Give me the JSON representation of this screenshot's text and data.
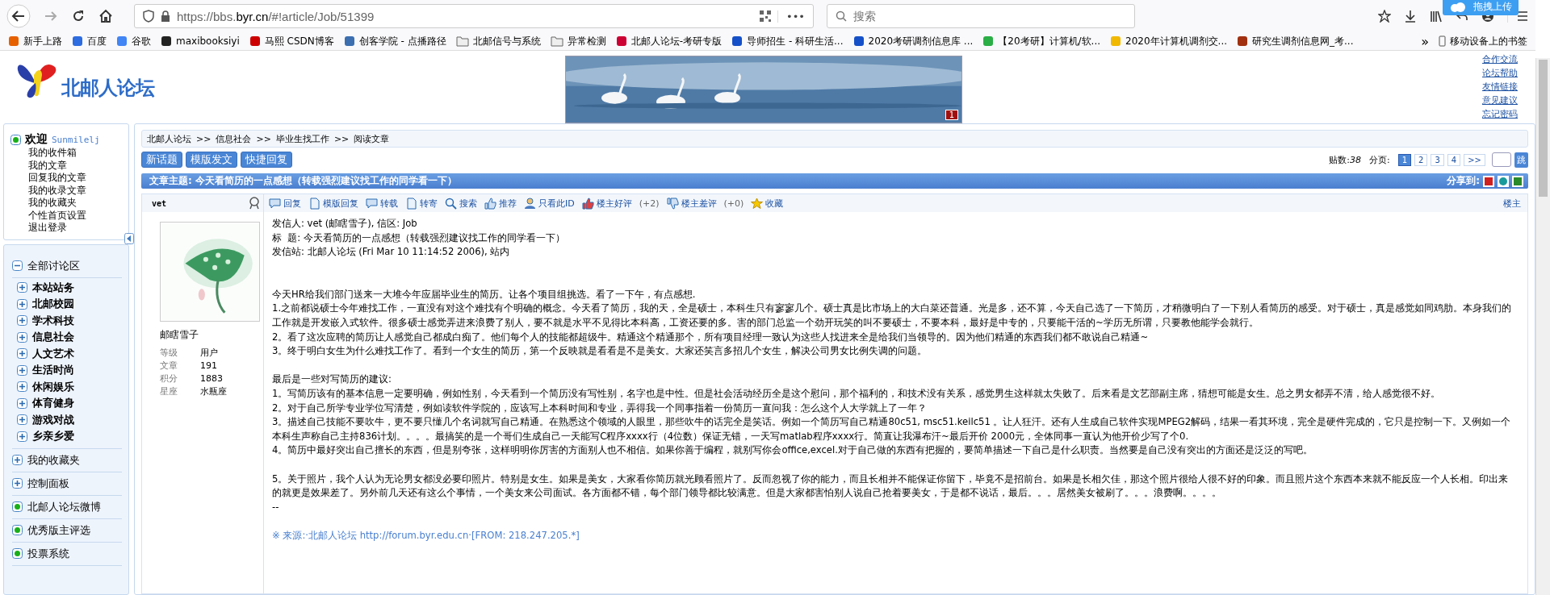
{
  "browser": {
    "url_prefix": "https://bbs.",
    "url_domain": "byr.cn",
    "url_path": "/#!article/Job/51399",
    "search_placeholder": "搜索",
    "more": "•••",
    "upload_popup": "拖拽上传",
    "bookmarks": [
      {
        "label": "新手上路",
        "kind": "site"
      },
      {
        "label": "百度",
        "kind": "site"
      },
      {
        "label": "谷歌",
        "kind": "site"
      },
      {
        "label": "maxibooksiyi",
        "kind": "site"
      },
      {
        "label": "马熙 CSDN博客",
        "kind": "site"
      },
      {
        "label": "创客学院 - 点播路径",
        "kind": "site"
      },
      {
        "label": "北邮信号与系统",
        "kind": "folder"
      },
      {
        "label": "异常检测",
        "kind": "folder"
      },
      {
        "label": "北邮人论坛-考研专版",
        "kind": "site"
      },
      {
        "label": "导师招生 - 科研生活...",
        "kind": "site"
      },
      {
        "label": "2020考研调剂信息库 ...",
        "kind": "site"
      },
      {
        "label": "【20考研】计算机/软...",
        "kind": "site"
      },
      {
        "label": "2020年计算机调剂交...",
        "kind": "site"
      },
      {
        "label": "研究生调剂信息网_考...",
        "kind": "site"
      }
    ],
    "overflow": "»",
    "mobile_bookmarks": "移动设备上的书签"
  },
  "header": {
    "logo_text": "北邮人论坛",
    "banner_badge": "1",
    "links": [
      "合作交流",
      "论坛帮助",
      "友情链接",
      "意见建议",
      "忘记密码"
    ]
  },
  "welcome": {
    "greeting": "欢迎",
    "username": "Sunmilelj",
    "links": [
      "我的收件箱",
      "我的文章",
      "回复我的文章",
      "我的收录文章",
      "我的收藏夹",
      "个性首页设置",
      "退出登录"
    ]
  },
  "nav": [
    {
      "label": "全部讨论区",
      "kind": "toggle",
      "expanded": true,
      "children": [
        {
          "label": "本站站务",
          "expanded": false
        },
        {
          "label": "北邮校园",
          "expanded": false
        },
        {
          "label": "学术科技",
          "expanded": false
        },
        {
          "label": "信息社会",
          "expanded": false
        },
        {
          "label": "人文艺术",
          "expanded": false
        },
        {
          "label": "生活时尚",
          "expanded": false
        },
        {
          "label": "休闲娱乐",
          "expanded": false
        },
        {
          "label": "体育健身",
          "expanded": false
        },
        {
          "label": "游戏对战",
          "expanded": false
        },
        {
          "label": "乡亲乡爱",
          "expanded": false
        }
      ]
    },
    {
      "label": "我的收藏夹",
      "kind": "toggle",
      "expanded": false
    },
    {
      "label": "控制面板",
      "kind": "toggle",
      "expanded": false
    },
    {
      "label": "北邮人论坛微博",
      "kind": "link"
    },
    {
      "label": "优秀版主评选",
      "kind": "link"
    },
    {
      "label": "投票系统",
      "kind": "link"
    }
  ],
  "breadcrumb": [
    "北邮人论坛",
    "信息社会",
    "毕业生找工作",
    "阅读文章"
  ],
  "breadcrumb_sep": ">>",
  "actions": [
    "新话题",
    "模版发文",
    "快捷回复"
  ],
  "pager": {
    "count_label": "贴数:",
    "count": "38",
    "pages_label": "分页:",
    "pages": [
      {
        "label": "1",
        "selected": true
      },
      {
        "label": "2",
        "selected": false
      },
      {
        "label": "3",
        "selected": false
      },
      {
        "label": "4",
        "selected": false
      },
      {
        "label": ">>",
        "selected": false
      }
    ],
    "go": "跳"
  },
  "subject": "文章主题: 今天看简历的一点感想（转载强烈建议找工作的同学看一下）",
  "share_label": "分享到:",
  "post": {
    "author": "vet",
    "nickname": "邮瞎雪子",
    "stats": [
      {
        "label": "等级",
        "value": "用户"
      },
      {
        "label": "文章",
        "value": "191"
      },
      {
        "label": "积分",
        "value": "1883"
      },
      {
        "label": "星座",
        "value": "水瓶座"
      }
    ],
    "tools": [
      "回复",
      "模版回复",
      "转载",
      "转寄",
      "搜索",
      "推荐",
      "只看此ID",
      "楼主好评",
      "楼主差评",
      "收藏"
    ],
    "good_count": "(+2)",
    "bad_count": "(+0)",
    "floor": "楼主",
    "head": [
      "发信人: vet (邮瞎雪子), 信区: Job",
      "标  题: 今天看简历的一点感想（转载强烈建议找工作的同学看一下）",
      "发信站: 北邮人论坛 (Fri Mar 10 11:14:52 2006), 站内"
    ],
    "blocks": [
      [
        "今天HR给我们部门送来一大堆今年应届毕业生的简历。让各个项目组挑选。看了一下午，有点感想.",
        "1.之前都说硕士今年难找工作，一直没有对这个难找有个明确的概念。今天看了简历，我的天，全是硕士，本科生只有寥寥几个。硕士真是比市场上的大白菜还普通。光是多，还不算，今天自己选了一下简历，才稍微明白了一下别人看简历的感受。对于硕士，真是感觉如同鸡肋。本身我们的工作就是开发嵌入式软件。很多硕士感觉弄进来浪费了别人，要不就是水平不见得比本科高，工资还要的多。害的部门总监一个劲开玩笑的叫不要硕士，不要本科，最好是中专的，只要能干活的~学历无所谓，只要教他能学会就行。",
        "2。看了这次应聘的简历让人感觉自己都成白痴了。他们每个人的技能都超级牛。精通这个精通那个，所有项目经理一致认为这些人找进来全是给我们当领导的。因为他们精通的东西我们都不敢说自己精通~",
        "3。终于明白女生为什么难找工作了。看到一个女生的简历，第一个反映就是看看是不是美女。大家还笑言多招几个女生，解决公司男女比例失调的问题。"
      ],
      [
        "最后是一些对写简历的建议:",
        "1。写简历该有的基本信息一定要明确，例如性别，今天看到一个简历没有写性别，名字也是中性。但是社会活动经历全是这个慰问，那个福利的，和技术没有关系，感觉男生这样就太失败了。后来看是文艺部副主席，猜想可能是女生。总之男女都弄不清，给人感觉很不好。",
        "2。对于自己所学专业学位写清楚，例如读软件学院的，应该写上本科时间和专业，弄得我一个同事指着一份简历一直问我：怎么这个人大学就上了一年？",
        "3。描述自己技能不要吹牛，更不要只懂几个名词就写自己精通。在熟悉这个领域的人眼里，那些吹牛的话完全是笑话。例如一个简历写自己精通80c51, msc51.keilc51 。让人狂汗。还有人生成自己软件实现MPEG2解码，结果一看其环境，完全是硬件完成的，它只是控制一下。又例如一个本科生声称自己主持836计划。。。。最搞笑的是一个哥们生成自己一天能写C程序xxxx行（4位数）保证无错，一天写matlab程序xxxx行。简直让我瀑布汗~最后开价 2000元，全体同事一直认为他开价少写了个0.",
        "4。简历中最好突出自己擅长的东西，但是别夸张，这样明明你厉害的方面别人也不相信。如果你善于编程，就别写你会office,excel.对于自己做的东西有把握的，要简单描述一下自己是什么职责。当然要是自己没有突出的方面还是泛泛的写吧。"
      ],
      [
        "5。关于照片，我个人认为无论男女都没必要印照片。特别是女生。如果是美女，大家看你简历就光顾看照片了。反而忽视了你的能力，而且长相并不能保证你留下，毕竟不是招前台。如果是长相欠佳，那这个照片很给人很不好的印象。而且照片这个东西本来就不能反应一个人长相。印出来的就更是效果差了。另外前几天还有这么个事情，一个美女来公司面试。各方面都不错，每个部门领导都比较满意。但是大家都害怕别人说自己抢着要美女，于是都不说话，最后。。。居然美女被刷了。。。浪费啊。。。。",
        "--"
      ]
    ],
    "source": "※ 来源:·北邮人论坛 http://forum.byr.edu.cn·[FROM: 218.247.205.*]"
  }
}
